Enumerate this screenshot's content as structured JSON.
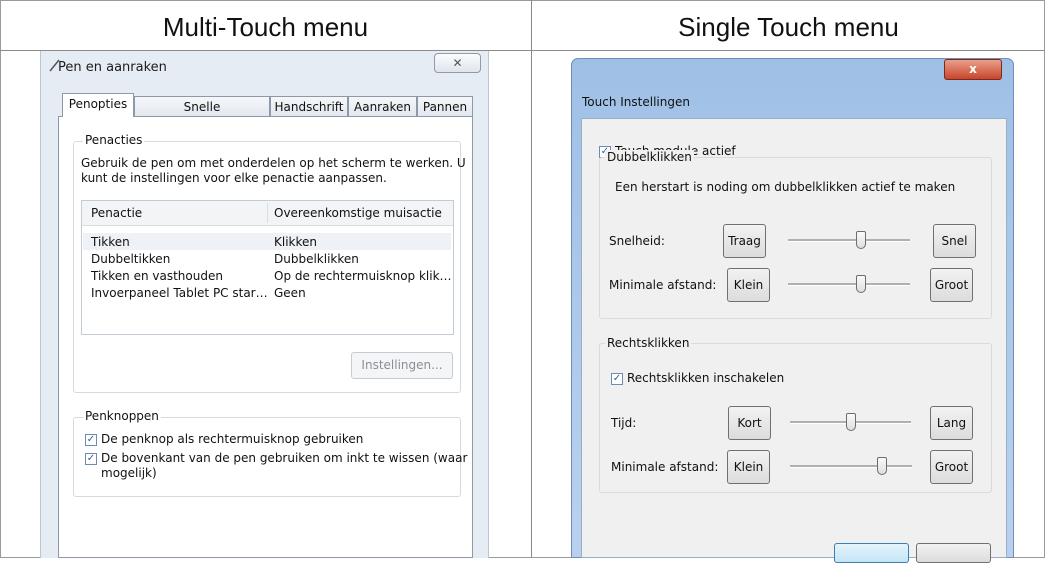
{
  "headers": {
    "left": "Multi-Touch menu",
    "right": "Single Touch menu"
  },
  "left": {
    "window_title": "Pen en aanraken",
    "close_glyph": "✕",
    "tabs": [
      "Penopties",
      "Snelle penbewegingen",
      "Handschrift",
      "Aanraken",
      "Pannen"
    ],
    "penacties": {
      "legend": "Penacties",
      "description_line1": "Gebruik de pen om met onderdelen op het scherm te werken. U",
      "description_line2": "kunt de instellingen voor elke penactie aanpassen.",
      "columns": [
        "Penactie",
        "Overeenkomstige muisactie"
      ],
      "rows": [
        [
          "Tikken",
          "Klikken"
        ],
        [
          "Dubbeltikken",
          "Dubbelklikken"
        ],
        [
          "Tikken en vasthouden",
          "Op de rechtermuisknop klik…"
        ],
        [
          "Invoerpaneel Tablet PC star…",
          "Geen"
        ]
      ],
      "settings_button": "Instellingen..."
    },
    "penknoppen": {
      "legend": "Penknoppen",
      "check1": "De penknop als rechtermuisknop gebruiken",
      "check2_line1": "De bovenkant van de pen gebruiken om inkt te wissen (waar",
      "check2_line2": "mogelijk)"
    }
  },
  "right": {
    "window_title": "Touch Instellingen",
    "close_glyph": "x",
    "touch_module": "Touch module actief",
    "dubbelklikken": {
      "legend": "Dubbelklikken",
      "note": "Een herstart is noding om dubbelklikken actief te maken",
      "snelheid": {
        "label": "Snelheid:",
        "min": "Traag",
        "max": "Snel",
        "level": 0.6
      },
      "afstand": {
        "label": "Minimale afstand:",
        "min": "Klein",
        "max": "Groot",
        "level": 0.6
      }
    },
    "rechtsklikken": {
      "legend": "Rechtsklikken",
      "enable": "Rechtsklikken inschakelen",
      "tijd": {
        "label": "Tijd:",
        "min": "Kort",
        "max": "Lang",
        "level": 0.5
      },
      "afstand": {
        "label": "Minimale afstand:",
        "min": "Klein",
        "max": "Groot",
        "level": 0.75
      }
    }
  },
  "check_glyph": "✓"
}
